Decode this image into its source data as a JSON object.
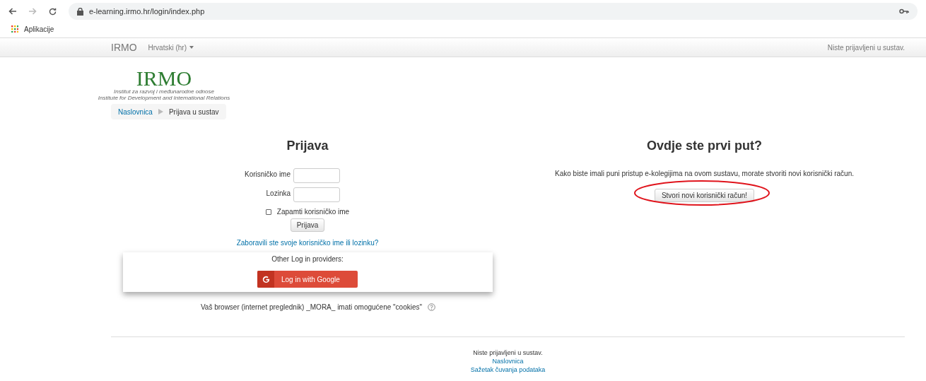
{
  "browser": {
    "url": "e-learning.irmo.hr/login/index.php",
    "bookmarks": [
      "Aplikacije"
    ]
  },
  "navbar": {
    "brand": "IRMO",
    "language": "Hrvatski (hr)",
    "login_status": "Niste prijavljeni u sustav."
  },
  "logo": {
    "title": "IRMO",
    "subtitle_lines": [
      "Institut za razvoj i međunarodne odnose",
      "Institute for Development and International Relations"
    ]
  },
  "breadcrumb": [
    {
      "label": "Naslovnica",
      "kind": "link"
    },
    {
      "label": "Prijava u sustav",
      "kind": "current"
    }
  ],
  "login": {
    "heading": "Prijava",
    "fields": [
      {
        "label": "Korisničko ime"
      },
      {
        "label": "Lozinka"
      }
    ],
    "remember": {
      "label": "Zapamti korisničko ime",
      "checked": false
    },
    "submit": "Prijava",
    "forgot_link": "Zaboravili ste svoje korisničko ime ili lozinku?",
    "other_providers": {
      "heading": "Other Log in providers:",
      "button": "Log in with Google"
    },
    "cookies_note": "Vaš browser (internet preglednik) _MORA_ imati omogućene \"cookies\""
  },
  "signup": {
    "heading": "Ovdje ste prvi put?",
    "text": "Kako biste imali puni pristup e-kolegijima na ovom sustavu, morate stvoriti novi korisnički račun.",
    "button": "Stvori novi korisnički račun!",
    "highlighted": true
  },
  "footer": {
    "status": "Niste prijavljeni u sustav.",
    "links": [
      "Naslovnica",
      "Sažetak čuvanja podataka"
    ]
  }
}
